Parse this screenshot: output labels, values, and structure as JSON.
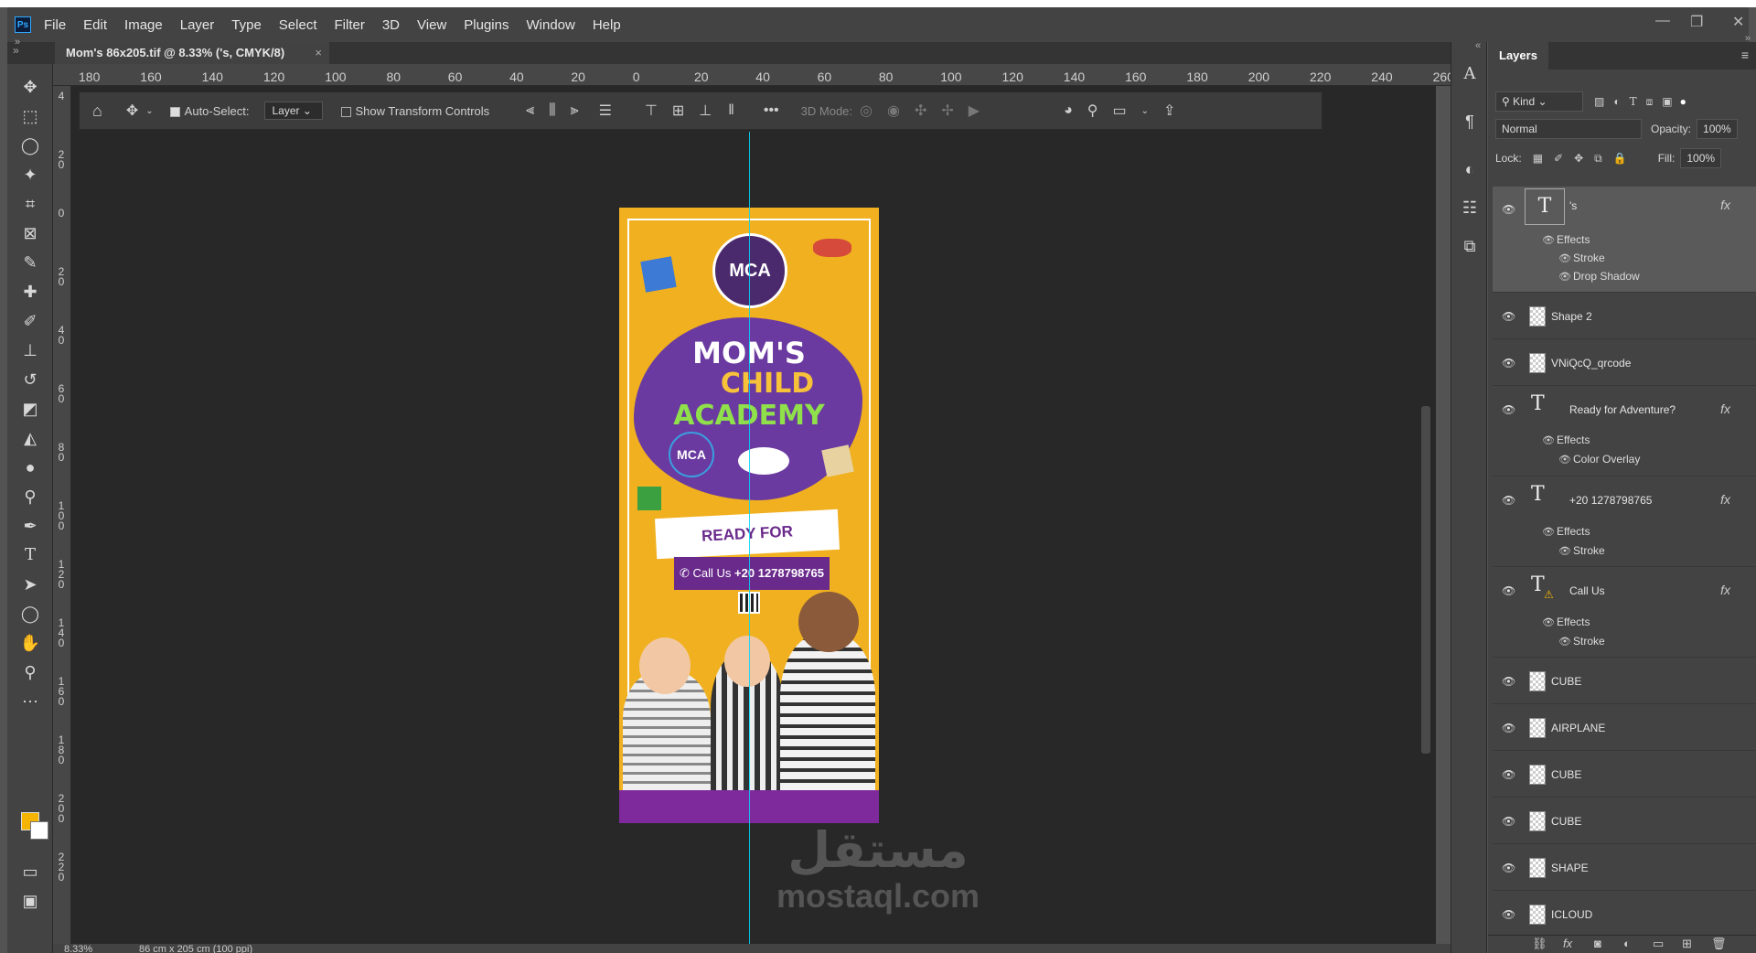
{
  "app": {
    "menus": [
      "File",
      "Edit",
      "Image",
      "Layer",
      "Type",
      "Select",
      "Filter",
      "3D",
      "View",
      "Plugins",
      "Window",
      "Help"
    ],
    "logo_text": "Ps"
  },
  "document_tab": {
    "title": "Mom's 86x205.tif @ 8.33% ('s, CMYK/8)",
    "close": "×"
  },
  "ruler_top_ticks": [
    "180",
    "160",
    "140",
    "120",
    "100",
    "80",
    "60",
    "40",
    "20",
    "0",
    "20",
    "40",
    "60",
    "80",
    "100",
    "120",
    "140",
    "160",
    "180",
    "200",
    "220",
    "240",
    "260"
  ],
  "ruler_left_ticks": [
    "4",
    "2\n0",
    "0",
    "2\n0",
    "4\n0",
    "6\n0",
    "8\n0",
    "1\n0\n0",
    "1\n2\n0",
    "1\n4\n0",
    "1\n6\n0",
    "1\n8\n0",
    "2\n0\n0",
    "2\n2\n0"
  ],
  "options_bar": {
    "auto_select_label": "Auto-Select:",
    "auto_select_checked": true,
    "layer_select": "Layer",
    "show_transform_label": "Show Transform Controls",
    "mode_3d_label": "3D Mode:"
  },
  "poster": {
    "logo": "MCA",
    "brand_line1": "MOM'S",
    "brand_line2": "CHILD",
    "brand_line3": "ACADEMY",
    "blob_logo": "MCA",
    "headline": "READY FOR ADVENTURE?",
    "call_label": "Call Us",
    "phone": "+20 1278798765"
  },
  "watermark": {
    "arabic": "مستقل",
    "latin": "mostaql.com"
  },
  "status": {
    "zoom": "8.33%",
    "doc_size": "86 cm x 205 cm (100 ppi)"
  },
  "layers_panel": {
    "tab": "Layers",
    "filter_kind": "Kind",
    "blend_mode": "Normal",
    "opacity_label": "Opacity:",
    "opacity_value": "100%",
    "lock_label": "Lock:",
    "fill_label": "Fill:",
    "fill_value": "100%",
    "layers": [
      {
        "name": "'s",
        "type": "text",
        "fx": true,
        "effects": [
          "Stroke",
          "Drop Shadow"
        ]
      },
      {
        "name": "Shape 2",
        "type": "smart"
      },
      {
        "name": "VNiQcQ_qrcode",
        "type": "raster"
      },
      {
        "name": "Ready for Adventure?",
        "type": "text",
        "fx": true,
        "effects": [
          "Color Overlay"
        ]
      },
      {
        "name": "+20 1278798765",
        "type": "text",
        "fx": true,
        "effects": [
          "Stroke"
        ]
      },
      {
        "name": "Call Us",
        "type": "text-warning",
        "fx": true,
        "effects": [
          "Stroke"
        ]
      },
      {
        "name": "CUBE",
        "type": "smart"
      },
      {
        "name": "AIRPLANE",
        "type": "smart"
      },
      {
        "name": "CUBE",
        "type": "smart"
      },
      {
        "name": "CUBE",
        "type": "smart"
      },
      {
        "name": "SHAPE",
        "type": "smart"
      },
      {
        "name": "ICLOUD",
        "type": "smart"
      }
    ],
    "effects_label": "Effects"
  },
  "colors": {
    "foreground": "#f5b400",
    "background": "#ffffff",
    "guide": "#00d7ff",
    "poster_bg": "#f0b020",
    "purple": "#6a2a8c"
  }
}
